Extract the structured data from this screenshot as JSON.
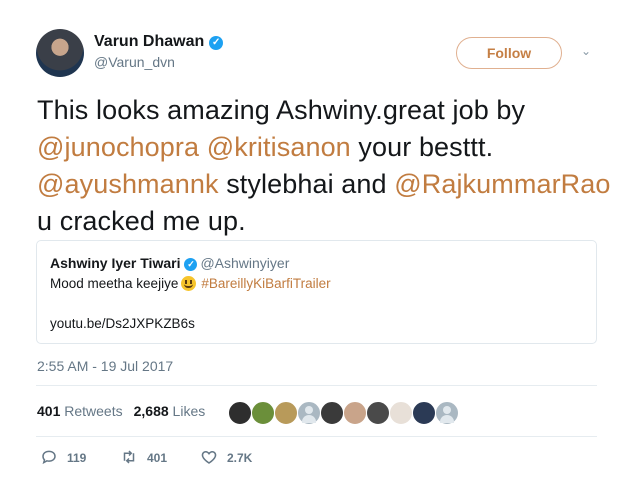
{
  "author": {
    "name": "Varun Dhawan",
    "handle": "@Varun_dvn",
    "verified_icon": "verified-badge-icon"
  },
  "follow_label": "Follow",
  "tweet_text": [
    {
      "t": "This looks amazing Ashwiny.great job by ",
      "m": false
    },
    {
      "t": "@junochopra",
      "m": true
    },
    {
      "t": " ",
      "m": false
    },
    {
      "t": "@kritisanon",
      "m": true
    },
    {
      "t": " your besttt. ",
      "m": false
    },
    {
      "t": "@ayushmannk",
      "m": true
    },
    {
      "t": " stylebhai and ",
      "m": false
    },
    {
      "t": "@RajkummarRao",
      "m": true
    },
    {
      "t": " u cracked me up.",
      "m": false
    }
  ],
  "quote": {
    "name": "Ashwiny Iyer Tiwari",
    "handle": "@Ashwinyiyer",
    "text": "Mood meetha keejiye",
    "emoji": "smiley-emoji",
    "hashtag": "#BareillyKiBarfiTrailer",
    "link": "youtu.be/Ds2JXPKZB6s"
  },
  "timestamp": "2:55 AM - 19 Jul 2017",
  "stats": {
    "retweets_count": "401",
    "retweets_label": "Retweets",
    "likes_count": "2,688",
    "likes_label": "Likes"
  },
  "likers": [
    "#2e2e2e",
    "#6b8f3a",
    "#b89a5a",
    "gray",
    "#3a3a3a",
    "#c9a48a",
    "#4a4a4a",
    "#e8e0d8",
    "#2b3a55",
    "gray"
  ],
  "actions": {
    "replies": "119",
    "retweets": "401",
    "likes": "2.7K"
  },
  "colors": {
    "accent": "#c17c40",
    "muted": "#657786",
    "verified": "#1da1f2"
  }
}
